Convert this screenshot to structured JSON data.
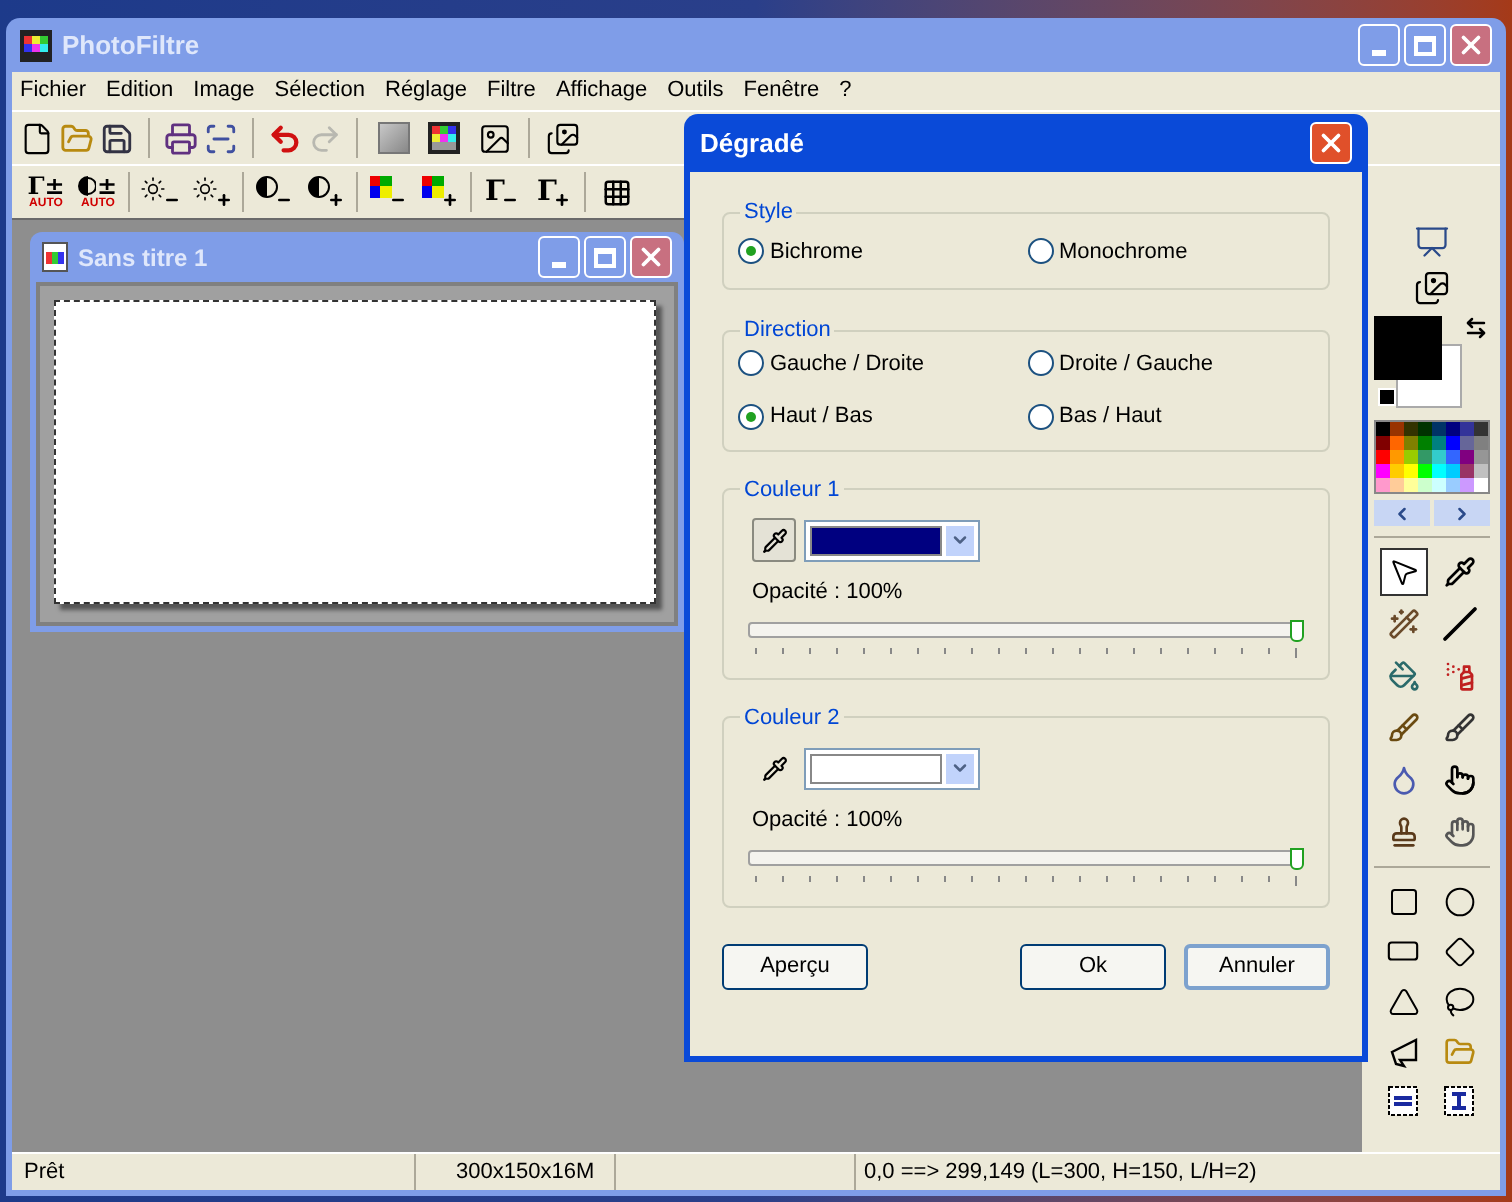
{
  "window": {
    "title": "PhotoFiltre"
  },
  "menu": [
    "Fichier",
    "Edition",
    "Image",
    "Sélection",
    "Réglage",
    "Filtre",
    "Affichage",
    "Outils",
    "Fenêtre",
    "?"
  ],
  "toolbar_2": [
    {
      "kind": "gamma-auto",
      "glyph": "Γ±",
      "sub": "AUTO"
    },
    {
      "kind": "contrast-auto",
      "glyph": "±",
      "sub": "AUTO"
    },
    {
      "kind": "brightness-down"
    },
    {
      "kind": "brightness-up"
    },
    {
      "kind": "contrast-down"
    },
    {
      "kind": "contrast-up"
    },
    {
      "kind": "color-down"
    },
    {
      "kind": "color-up"
    },
    {
      "kind": "gamma-down",
      "glyph": "Γ"
    },
    {
      "kind": "gamma-up",
      "glyph": "Γ"
    },
    {
      "kind": "grid"
    }
  ],
  "document": {
    "title": "Sans titre 1"
  },
  "tools": [
    {
      "kind": "pointer",
      "selected": true
    },
    {
      "kind": "pipette",
      "selected": false
    },
    {
      "kind": "wand",
      "selected": false
    },
    {
      "kind": "line",
      "selected": false
    },
    {
      "kind": "bucket",
      "selected": false
    },
    {
      "kind": "spray",
      "selected": false
    },
    {
      "kind": "brush",
      "selected": false
    },
    {
      "kind": "brush-plus",
      "selected": false
    },
    {
      "kind": "drop",
      "selected": false
    },
    {
      "kind": "finger",
      "selected": false
    },
    {
      "kind": "stamp",
      "selected": false
    },
    {
      "kind": "hand",
      "selected": false
    }
  ],
  "dialog": {
    "title": "Dégradé",
    "style": {
      "label": "Style",
      "options": [
        {
          "label": "Bichrome",
          "selected": true
        },
        {
          "label": "Monochrome",
          "selected": false
        }
      ]
    },
    "direction": {
      "label": "Direction",
      "options": [
        {
          "label": "Gauche / Droite",
          "selected": false
        },
        {
          "label": "Droite / Gauche",
          "selected": false
        },
        {
          "label": "Haut / Bas",
          "selected": true
        },
        {
          "label": "Bas / Haut",
          "selected": false
        }
      ]
    },
    "colors": [
      {
        "label": "Couleur 1",
        "color": "#000080",
        "picker_pressed": true,
        "opacity": "Opacité : 100%",
        "level": 1
      },
      {
        "label": "Couleur 2",
        "color": "#ffffff",
        "picker_pressed": false,
        "opacity": "Opacité : 100%",
        "level": 1
      }
    ],
    "buttons": [
      {
        "label": "Aperçu",
        "focused": false
      },
      {
        "label": "Ok",
        "focused": false
      },
      {
        "label": "Annuler",
        "focused": true
      }
    ]
  },
  "status_bar": [
    "Prêt",
    "300x150x16M",
    "0,0 ==> 299,149 (L=300, H=150, L/H=2)"
  ]
}
